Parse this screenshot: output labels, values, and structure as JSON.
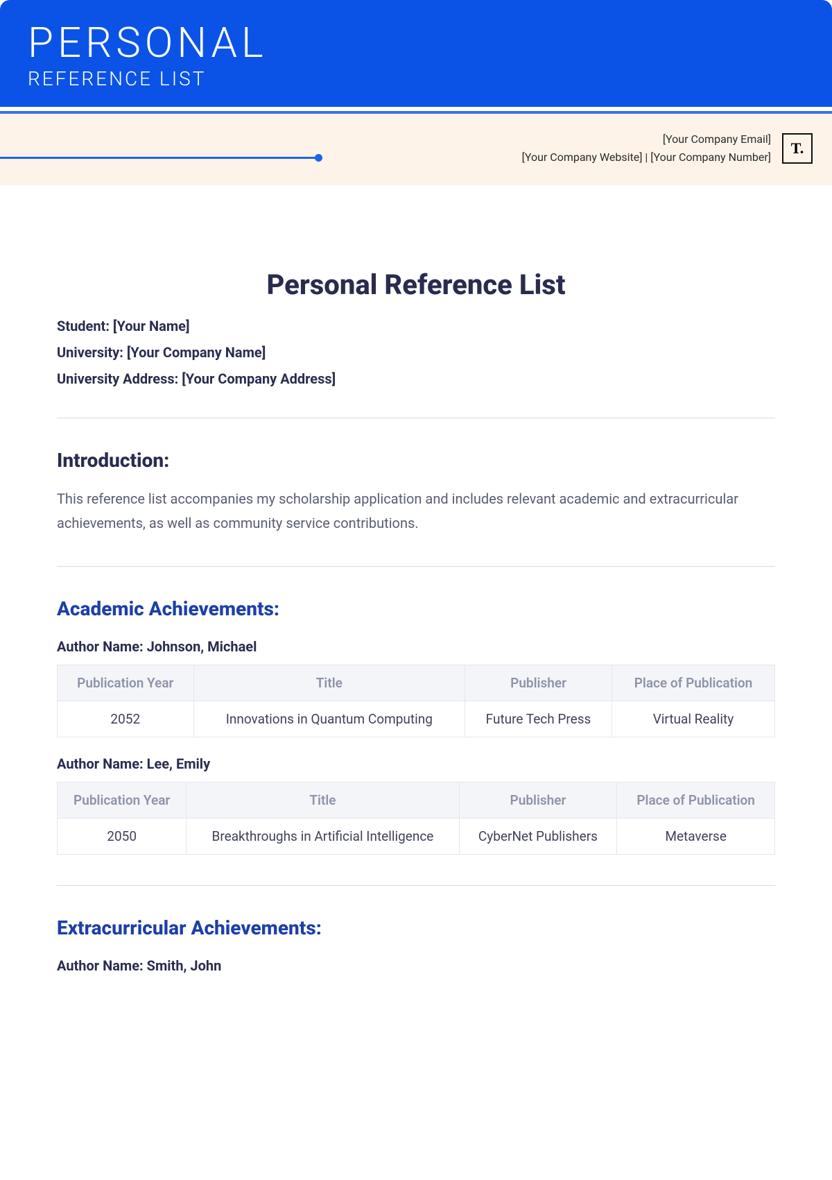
{
  "hero": {
    "title": "PERSONAL",
    "subtitle": "REFERENCE LIST"
  },
  "contact": {
    "email": "[Your Company Email]",
    "line2": "[Your Company Website]  |  [Your Company Number]",
    "logo_text": "T."
  },
  "doc": {
    "title": "Personal Reference List",
    "student_label": "Student: [Your Name]",
    "university_label": "University: [Your Company Name]",
    "address_label": "University Address: [Your Company Address]"
  },
  "intro": {
    "heading": "Introduction:",
    "text": "This reference list accompanies my scholarship application and includes relevant academic and extracurricular achievements, as well as community service contributions."
  },
  "academic": {
    "heading": "Academic Achievements:",
    "columns": {
      "c1": "Publication Year",
      "c2": "Title",
      "c3": "Publisher",
      "c4": "Place of Publication"
    },
    "entries": [
      {
        "author_line": "Author Name: Johnson, Michael",
        "row": {
          "year": "2052",
          "title": "Innovations in Quantum Computing",
          "publisher": "Future Tech Press",
          "place": "Virtual Reality"
        }
      },
      {
        "author_line": "Author Name: Lee, Emily",
        "row": {
          "year": "2050",
          "title": "Breakthroughs in Artificial Intelligence",
          "publisher": "CyberNet Publishers",
          "place": "Metaverse"
        }
      }
    ]
  },
  "extracurricular": {
    "heading": "Extracurricular Achievements:",
    "author_line": "Author Name: Smith, John"
  }
}
